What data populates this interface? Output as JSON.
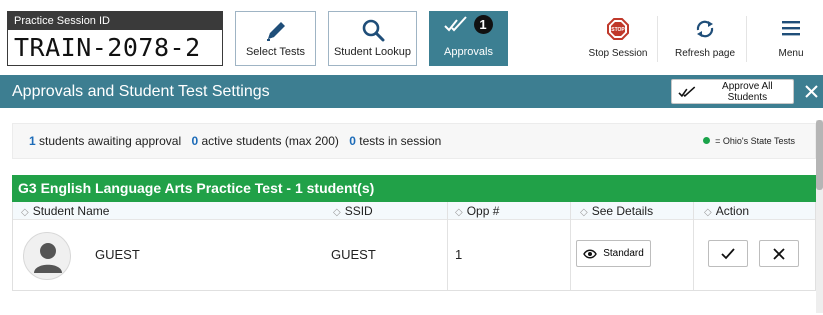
{
  "session": {
    "label": "Practice Session ID",
    "id": "TRAIN-2078-2"
  },
  "toolbar": {
    "select_tests": "Select Tests",
    "student_lookup": "Student Lookup",
    "approvals": "Approvals",
    "approvals_count": "1",
    "stop_session": "Stop Session",
    "refresh_page": "Refresh page",
    "menu": "Menu"
  },
  "section": {
    "title": "Approvals and Student Test Settings",
    "approve_all": "Approve All Students"
  },
  "stats": {
    "awaiting_count": "1",
    "awaiting_label": "students awaiting approval",
    "active_count": "0",
    "active_label": "active students (max 200)",
    "tests_count": "0",
    "tests_label": "tests in session",
    "legend": "= Ohio's State Tests"
  },
  "test_group": {
    "title": "G3 English Language Arts Practice Test -  1 student(s)",
    "columns": [
      "Student Name",
      "SSID",
      "Opp #",
      "See Details",
      "Action"
    ],
    "rows": [
      {
        "name": "GUEST",
        "ssid": "GUEST",
        "opp": "1",
        "details": "Standard"
      }
    ]
  },
  "colors": {
    "accent": "#3d7e91",
    "group_header": "#21a148",
    "count_blue": "#1c6bb8",
    "stop_red": "#c0392b",
    "legend_dot": "#1aa34a"
  },
  "icons": {
    "select_tests": "pencil-icon",
    "student_lookup": "search-icon",
    "approvals": "double-check-icon",
    "stop_session": "stop-sign-icon",
    "refresh_page": "refresh-icon",
    "menu": "hamburger-icon"
  }
}
